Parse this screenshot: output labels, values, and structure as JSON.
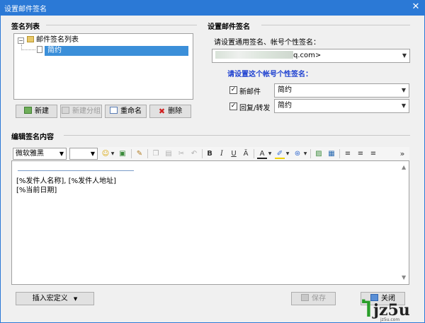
{
  "window": {
    "title": "设置邮件签名",
    "close_glyph": "✕"
  },
  "left": {
    "section_title": "签名列表",
    "tree": {
      "root_label": "邮件签名列表",
      "root_expander": "−",
      "child_label": "简约"
    },
    "buttons": {
      "new": "新建",
      "new_group": "新建分组",
      "rename": "重命名",
      "delete": "删除"
    }
  },
  "right": {
    "section_title": "设置邮件签名",
    "prompt": "请设置通用签名、帐号个性签名：",
    "account_suffix": "q.com>",
    "personal_title": "请设置这个帐号个性签名：",
    "new_mail": {
      "label": "新邮件",
      "checked": true,
      "value": "简约"
    },
    "reply": {
      "label": "回复/转发",
      "checked": true,
      "value": "简约"
    }
  },
  "editor_section": {
    "title": "编辑签名内容",
    "font_name": "微软雅黑",
    "font_size": "",
    "toolbar_icons": [
      "emoji-icon",
      "image-insert-icon",
      "format-brush-icon",
      "copy-icon",
      "paste-icon",
      "cut-icon",
      "undo-icon",
      "bold-icon",
      "italic-icon",
      "underline-icon",
      "strikethrough-icon",
      "font-color-icon",
      "highlight-icon",
      "symbol-icon",
      "picture-icon",
      "table-icon",
      "align-left-icon",
      "align-center-icon",
      "align-right-icon",
      "more-icon"
    ],
    "toolbar_text": {
      "bold": "B",
      "italic": "I",
      "underline": "U",
      "strike": "Ā",
      "font_color": "A",
      "more": "»"
    },
    "lines": [
      "[%发件人名称], [%发件人地址]",
      "[%当前日期]"
    ]
  },
  "footer": {
    "insert_macro": "插入宏定义",
    "save": "保存",
    "close": "关闭"
  },
  "watermark": {
    "main": "jz5u",
    "sub": "jz5u.com"
  },
  "colors": {
    "titlebar": "#2b79d6",
    "selection": "#3b8fd9",
    "blue_label": "#1c3fd0"
  }
}
